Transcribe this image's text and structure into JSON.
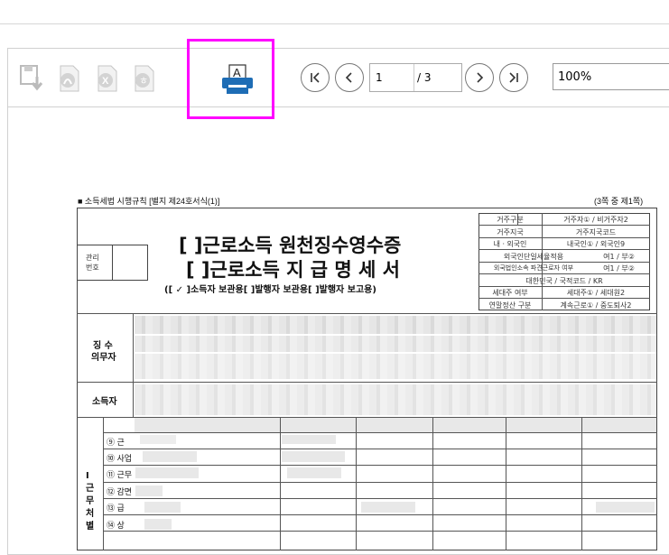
{
  "toolbar": {
    "icons": [
      "save-icon",
      "pdf-icon",
      "excel-icon",
      "hwp-icon"
    ],
    "print_letter": "A",
    "page_current": "1",
    "page_total": "/ 3",
    "zoom": "100%"
  },
  "document": {
    "header_left": "■ 소득세법 시행규칙 [별지 제24호서식(1)]",
    "header_right": "(3쪽 중 제1쪽)",
    "mgmt_label_1": "관리",
    "mgmt_label_2": "번호",
    "title_1": "[ ]근로소득 원천징수영수증",
    "title_2": "[ ]근로소득 지 급 명 세 서",
    "copy_types": "([ ✓ ]소득자 보관용[      ]발행자 보관용[      ]발행자 보고용)",
    "info_rows": [
      {
        "label": "거주구분",
        "value": "거주자① / 비거주자2"
      },
      {
        "label": "거주지국",
        "value": "거주지국코드"
      },
      {
        "label": "내ㆍ외국인",
        "value": "내국인① / 외국인9"
      },
      {
        "label": "외국인단일세율적용",
        "value": "여1 / 부②"
      },
      {
        "label": "외국법인소속 파견근로자 여부",
        "value": "여1 / 부②"
      },
      {
        "label": "국적",
        "value": "대한민국 / 국적코드 / KR"
      },
      {
        "label": "세대주 여부",
        "value": "세대주① / 세대원2"
      },
      {
        "label": "연말정산 구분",
        "value": "계속근로① / 중도퇴사2"
      }
    ],
    "withholder_label_1": "징 수",
    "withholder_label_2": "의무자",
    "earner_label": "소득자",
    "section_label": "Ⅰ 근 무 처 별",
    "row_items": [
      "⑨ 근",
      "⑩ 사업",
      "⑪ 근무",
      "⑫ 감면",
      "⑬ 급",
      "⑭ 상"
    ]
  }
}
